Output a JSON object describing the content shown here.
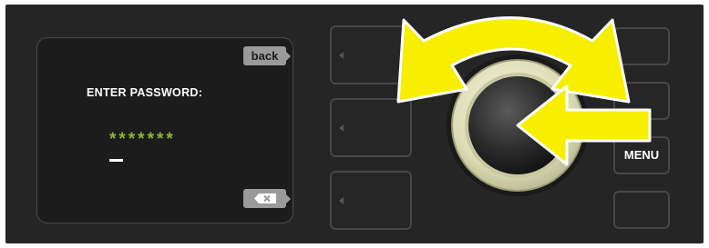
{
  "display": {
    "title": "ENTER PASSWORD:",
    "masked_password": "*******",
    "back_label": "back",
    "delete_glyph": "✖"
  },
  "controls": {
    "menu_label": "MENU"
  },
  "icons": {
    "delete": "backspace-icon",
    "rotate": "rotate-arrow-icon",
    "press": "press-arrow-icon"
  },
  "colors": {
    "panel": "#252525",
    "screen": "#1c1c1c",
    "password_text": "#8bb43a",
    "arrow_fill": "#f7ee00",
    "softkey_tag": "#9a9a9a",
    "knob_ring": "#ddddb8"
  }
}
